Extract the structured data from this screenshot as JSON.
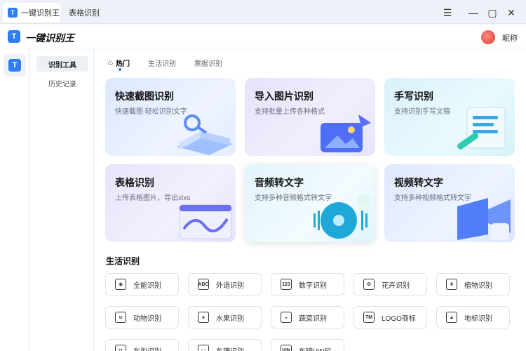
{
  "titlebar": {
    "tabs": [
      {
        "label": "一键识别王"
      },
      {
        "label": "表格识别"
      }
    ]
  },
  "header": {
    "app_name": "一键识别王",
    "logo_letter": "T",
    "nickname": "昵称"
  },
  "subnav": {
    "items": [
      {
        "label": "识别工具"
      },
      {
        "label": "历史记录"
      }
    ]
  },
  "category_tabs": [
    {
      "label": "热门"
    },
    {
      "label": "生活识别"
    },
    {
      "label": "票据识别"
    }
  ],
  "feature_cards": [
    {
      "title": "快速截图识别",
      "subtitle": "快速截图 轻松识别文字"
    },
    {
      "title": "导入图片识别",
      "subtitle": "支持批量上传各种格式"
    },
    {
      "title": "手写识别",
      "subtitle": "支持识别手写文稿"
    },
    {
      "title": "表格识别",
      "subtitle": "上传表格图片，导出xlxs"
    },
    {
      "title": "音频转文字",
      "subtitle": "支持多种音频格式转文字"
    },
    {
      "title": "视频转文字",
      "subtitle": "支持多种视频格式转文字"
    }
  ],
  "life_section": {
    "title": "生活识别",
    "tools": [
      {
        "label": "全能识别",
        "icon": "eye-scan-icon",
        "glyph": "◉"
      },
      {
        "label": "外语识别",
        "icon": "abc-icon",
        "glyph": "ABC"
      },
      {
        "label": "数字识别",
        "icon": "digits-icon",
        "glyph": "123"
      },
      {
        "label": "花卉识别",
        "icon": "flower-icon",
        "glyph": "✿"
      },
      {
        "label": "植物识别",
        "icon": "plant-icon",
        "glyph": "❦"
      },
      {
        "label": "动物识别",
        "icon": "animal-icon",
        "glyph": "ʊ"
      },
      {
        "label": "水果识别",
        "icon": "fruit-icon",
        "glyph": "●"
      },
      {
        "label": "蔬菜识别",
        "icon": "vegetable-icon",
        "glyph": "◒"
      },
      {
        "label": "LOGO商标",
        "icon": "trademark-icon",
        "glyph": "TM"
      },
      {
        "label": "地标识别",
        "icon": "landmark-icon",
        "glyph": "▲"
      },
      {
        "label": "车型识别",
        "icon": "car-icon",
        "glyph": "◘"
      },
      {
        "label": "车牌识别",
        "icon": "license-plate-icon",
        "glyph": "▭"
      },
      {
        "label": "车辆VIN码",
        "icon": "vin-icon",
        "glyph": "VIN"
      }
    ]
  },
  "colors": {
    "accent": "#2f7df6",
    "card_blue": "#dfe9ff",
    "card_cyan": "#dbf3fb",
    "card_lilac": "#e9e5fb"
  }
}
